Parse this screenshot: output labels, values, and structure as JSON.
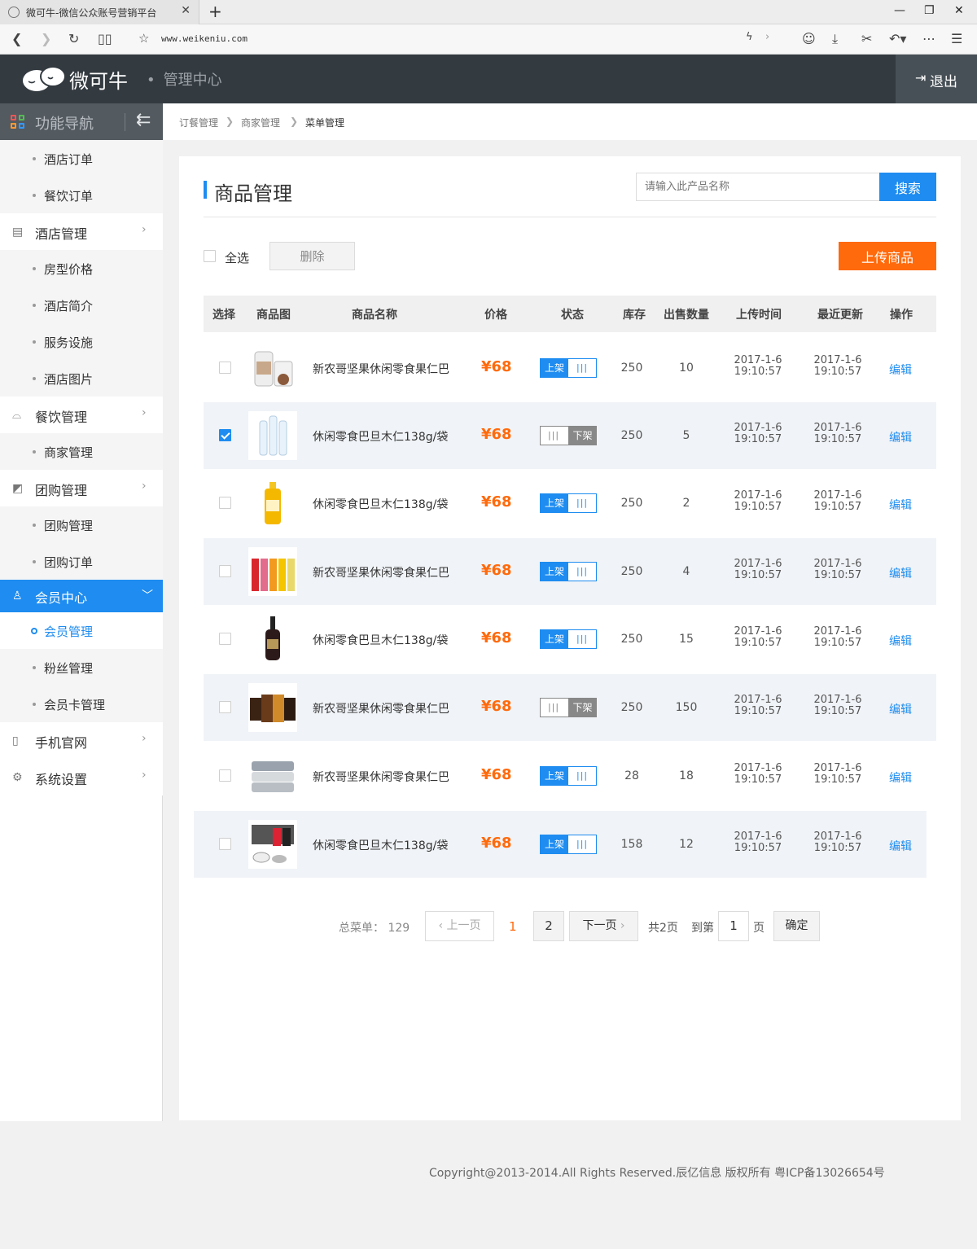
{
  "browser": {
    "tab_title": "微可牛-微信公众账号营销平台",
    "url": "www.weikeniu.com"
  },
  "header": {
    "logo_text": "微可牛",
    "subtitle": "管理中心",
    "logout": "退出"
  },
  "sidebar": {
    "head": "功能导航",
    "items": [
      {
        "kind": "sub",
        "label": "酒店订单"
      },
      {
        "kind": "sub",
        "label": "餐饮订单"
      },
      {
        "kind": "group",
        "label": "酒店管理",
        "icon": "building-icon"
      },
      {
        "kind": "sub",
        "label": "房型价格"
      },
      {
        "kind": "sub",
        "label": "酒店简介"
      },
      {
        "kind": "sub",
        "label": "服务设施"
      },
      {
        "kind": "sub",
        "label": "酒店图片"
      },
      {
        "kind": "group",
        "label": "餐饮管理",
        "icon": "dish-icon"
      },
      {
        "kind": "sub",
        "label": "商家管理"
      },
      {
        "kind": "group",
        "label": "团购管理",
        "icon": "chart-icon"
      },
      {
        "kind": "sub",
        "label": "团购管理"
      },
      {
        "kind": "sub",
        "label": "团购订单"
      },
      {
        "kind": "group",
        "label": "会员中心",
        "icon": "user-icon",
        "active": true
      },
      {
        "kind": "sub",
        "label": "会员管理",
        "current": true
      },
      {
        "kind": "sub",
        "label": "粉丝管理"
      },
      {
        "kind": "sub",
        "label": "会员卡管理"
      },
      {
        "kind": "group",
        "label": "手机官网",
        "icon": "phone-icon"
      },
      {
        "kind": "group",
        "label": "系统设置",
        "icon": "gear-icon"
      }
    ]
  },
  "breadcrumb": [
    "订餐管理",
    "商家管理",
    "菜单管理"
  ],
  "page": {
    "title": "商品管理",
    "search_placeholder": "请输入此产品名称",
    "search_button": "搜索",
    "select_all": "全选",
    "delete_button": "删除",
    "upload_button": "上传商品"
  },
  "table": {
    "headers": [
      "选择",
      "商品图",
      "商品名称",
      "价格",
      "状态",
      "库存",
      "出售数量",
      "上传时间",
      "最近更新",
      "操作"
    ],
    "status_on": "上架",
    "status_off": "下架",
    "edit_label": "编辑",
    "rows": [
      {
        "checked": false,
        "image": "nut-jar",
        "name": "新农哥坚果休闲零食果仁巴",
        "price": "¥68",
        "status": "on",
        "stock": "250",
        "sold": "10",
        "upload": "2017-1-6 19:10:57",
        "updated": "2017-1-6 19:10:57"
      },
      {
        "checked": true,
        "image": "water-bottles",
        "name": "休闲零食巴旦木仁138g/袋",
        "price": "¥68",
        "status": "off",
        "stock": "250",
        "sold": "5",
        "upload": "2017-1-6 19:10:57",
        "updated": "2017-1-6 19:10:57"
      },
      {
        "checked": false,
        "image": "juice-bottle",
        "name": "休闲零食巴旦木仁138g/袋",
        "price": "¥68",
        "status": "on",
        "stock": "250",
        "sold": "2",
        "upload": "2017-1-6 19:10:57",
        "updated": "2017-1-6 19:10:57"
      },
      {
        "checked": false,
        "image": "juice-set",
        "name": "新农哥坚果休闲零食果仁巴",
        "price": "¥68",
        "status": "on",
        "stock": "250",
        "sold": "4",
        "upload": "2017-1-6 19:10:57",
        "updated": "2017-1-6 19:10:57"
      },
      {
        "checked": false,
        "image": "wine-bottle",
        "name": "休闲零食巴旦木仁138g/袋",
        "price": "¥68",
        "status": "on",
        "stock": "250",
        "sold": "15",
        "upload": "2017-1-6 19:10:57",
        "updated": "2017-1-6 19:10:57"
      },
      {
        "checked": false,
        "image": "tea-cups",
        "name": "新农哥坚果休闲零食果仁巴",
        "price": "¥68",
        "status": "off",
        "stock": "250",
        "sold": "150",
        "upload": "2017-1-6 19:10:57",
        "updated": "2017-1-6 19:10:57"
      },
      {
        "checked": false,
        "image": "towels",
        "name": "新农哥坚果休闲零食果仁巴",
        "price": "¥68",
        "status": "on",
        "stock": "28",
        "sold": "18",
        "upload": "2017-1-6 19:10:57",
        "updated": "2017-1-6 19:10:57"
      },
      {
        "checked": false,
        "image": "socks",
        "name": "休闲零食巴旦木仁138g/袋",
        "price": "¥68",
        "status": "on",
        "stock": "158",
        "sold": "12",
        "upload": "2017-1-6 19:10:57",
        "updated": "2017-1-6 19:10:57"
      }
    ]
  },
  "pagination": {
    "total_label": "总菜单：",
    "total": "129",
    "prev": "上一页",
    "page1": "1",
    "page2": "2",
    "next": "下一页",
    "total_pages": "共2页",
    "goto_label": "到第",
    "goto_value": "1",
    "page_unit": "页",
    "confirm": "确定"
  },
  "footer": "Copyright@2013-2014.All Rights Reserved.辰亿信息 版权所有 粤ICP备13026654号",
  "colors": {
    "accent": "#1e8cf0",
    "orange": "#ff6a0c",
    "topbar": "#333a40"
  }
}
